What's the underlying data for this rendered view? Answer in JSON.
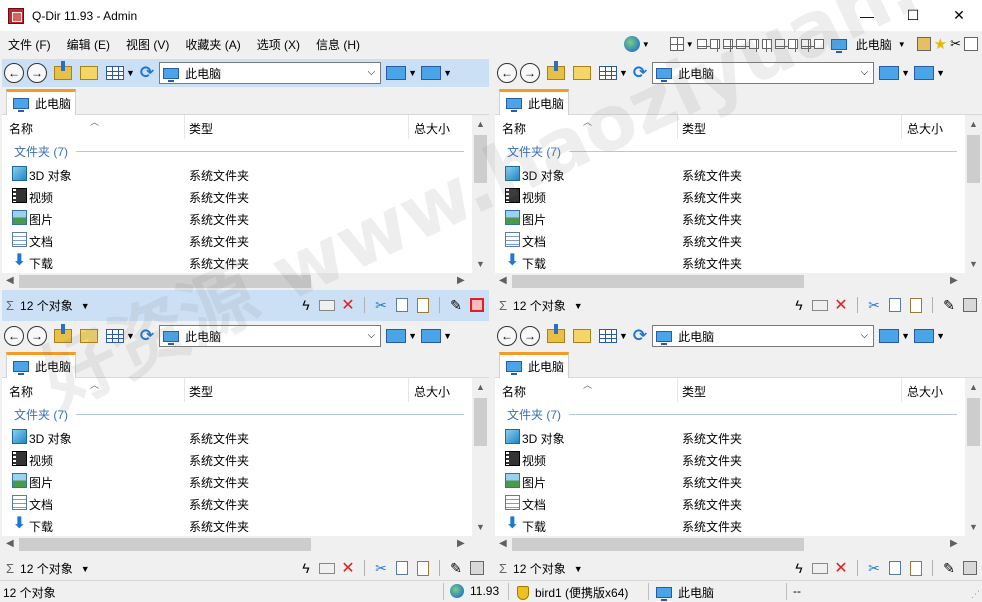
{
  "window": {
    "title": "Q-Dir 11.93 - Admin",
    "minimize_glyph": "—",
    "maximize_glyph": "☐",
    "close_glyph": "✕"
  },
  "menu": [
    "文件 (F)",
    "编辑 (E)",
    "视图 (V)",
    "收藏夹 (A)",
    "选项 (X)",
    "信息 (H)"
  ],
  "global_toolbar": {
    "location_label": "此电脑"
  },
  "watermark": "好资源 www.haoziyuan.com",
  "panels": [
    {
      "active": true,
      "address": "此电脑",
      "tab_label": "此电脑",
      "columns": [
        "名称",
        "类型",
        "总大小"
      ],
      "group_label": "文件夹 (7)",
      "rows": [
        {
          "icon": "3d-objects-icon",
          "name": "3D 对象",
          "type": "系统文件夹"
        },
        {
          "icon": "video-icon",
          "name": "视频",
          "type": "系统文件夹"
        },
        {
          "icon": "pictures-icon",
          "name": "图片",
          "type": "系统文件夹"
        },
        {
          "icon": "documents-icon",
          "name": "文档",
          "type": "系统文件夹"
        },
        {
          "icon": "download-icon",
          "name": "下载",
          "type": "系统文件夹"
        }
      ],
      "status": "12 个对象"
    },
    {
      "active": false,
      "address": "此电脑",
      "tab_label": "此电脑",
      "columns": [
        "名称",
        "类型",
        "总大小"
      ],
      "group_label": "文件夹 (7)",
      "rows": [
        {
          "icon": "3d-objects-icon",
          "name": "3D 对象",
          "type": "系统文件夹"
        },
        {
          "icon": "video-icon",
          "name": "视频",
          "type": "系统文件夹"
        },
        {
          "icon": "pictures-icon",
          "name": "图片",
          "type": "系统文件夹"
        },
        {
          "icon": "documents-icon",
          "name": "文档",
          "type": "系统文件夹"
        },
        {
          "icon": "download-icon",
          "name": "下载",
          "type": "系统文件夹"
        }
      ],
      "status": "12 个对象"
    },
    {
      "active": false,
      "address": "此电脑",
      "tab_label": "此电脑",
      "columns": [
        "名称",
        "类型",
        "总大小"
      ],
      "group_label": "文件夹 (7)",
      "rows": [
        {
          "icon": "3d-objects-icon",
          "name": "3D 对象",
          "type": "系统文件夹"
        },
        {
          "icon": "video-icon",
          "name": "视频",
          "type": "系统文件夹"
        },
        {
          "icon": "pictures-icon",
          "name": "图片",
          "type": "系统文件夹"
        },
        {
          "icon": "documents-icon",
          "name": "文档",
          "type": "系统文件夹"
        },
        {
          "icon": "download-icon",
          "name": "下载",
          "type": "系统文件夹"
        }
      ],
      "status": "12 个对象"
    },
    {
      "active": false,
      "address": "此电脑",
      "tab_label": "此电脑",
      "columns": [
        "名称",
        "类型",
        "总大小"
      ],
      "group_label": "文件夹 (7)",
      "rows": [
        {
          "icon": "3d-objects-icon",
          "name": "3D 对象",
          "type": "系统文件夹"
        },
        {
          "icon": "video-icon",
          "name": "视频",
          "type": "系统文件夹"
        },
        {
          "icon": "pictures-icon",
          "name": "图片",
          "type": "系统文件夹"
        },
        {
          "icon": "documents-icon",
          "name": "文档",
          "type": "系统文件夹"
        },
        {
          "icon": "download-icon",
          "name": "下载",
          "type": "系统文件夹"
        }
      ],
      "status": "12 个对象"
    }
  ],
  "statusbar": {
    "count": "12 个对象",
    "version": "11.93",
    "user": "bird1 (便携版x64)",
    "location": "此电脑",
    "extra": "--"
  },
  "colors": {
    "active_panel_bg": "#cce0f5",
    "tab_accent": "#f59a23",
    "group_text": "#3b6fb6"
  }
}
